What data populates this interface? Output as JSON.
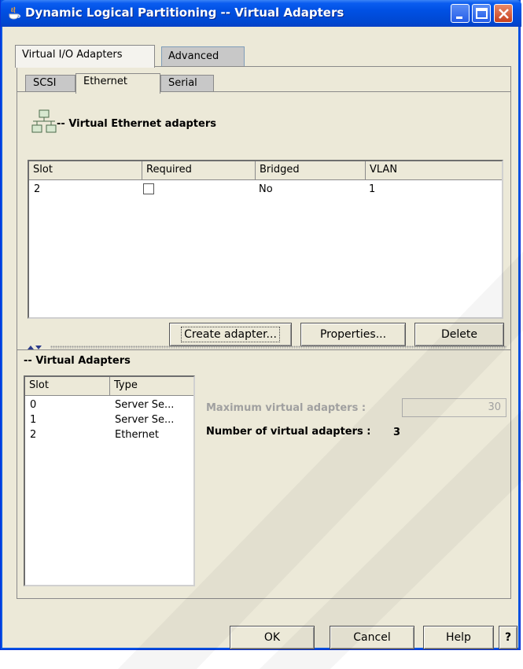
{
  "window": {
    "title": "Dynamic Logical Partitioning -- Virtual Adapters",
    "accent": "#0054e3",
    "close_color": "#c6401e"
  },
  "outer_tabs": [
    {
      "label": "Virtual I/O Adapters",
      "selected": true
    },
    {
      "label": "Advanced",
      "selected": false
    }
  ],
  "inner_tabs": [
    {
      "label": "SCSI",
      "selected": false
    },
    {
      "label": "Ethernet",
      "selected": true
    },
    {
      "label": "Serial",
      "selected": false
    }
  ],
  "ethernet": {
    "title": "-- Virtual Ethernet adapters",
    "icon": "network-icon",
    "columns": [
      "Slot",
      "Required",
      "Bridged",
      "VLAN"
    ],
    "rows": [
      {
        "slot": "2",
        "required": false,
        "bridged": "No",
        "vlan": "1"
      }
    ],
    "buttons": {
      "create": "Create adapter...",
      "properties": "Properties...",
      "delete": "Delete"
    }
  },
  "virtual_adapters": {
    "title": "-- Virtual Adapters",
    "columns": [
      "Slot",
      "Type"
    ],
    "rows": [
      {
        "slot": "0",
        "type": "Server Se..."
      },
      {
        "slot": "1",
        "type": "Server Se..."
      },
      {
        "slot": "2",
        "type": "Ethernet"
      }
    ],
    "max_label": "Maximum virtual adapters :",
    "max_value": "30",
    "count_label": "Number of virtual adapters :",
    "count_value": "3"
  },
  "footer": {
    "ok": "OK",
    "cancel": "Cancel",
    "help": "Help",
    "question": "?"
  }
}
